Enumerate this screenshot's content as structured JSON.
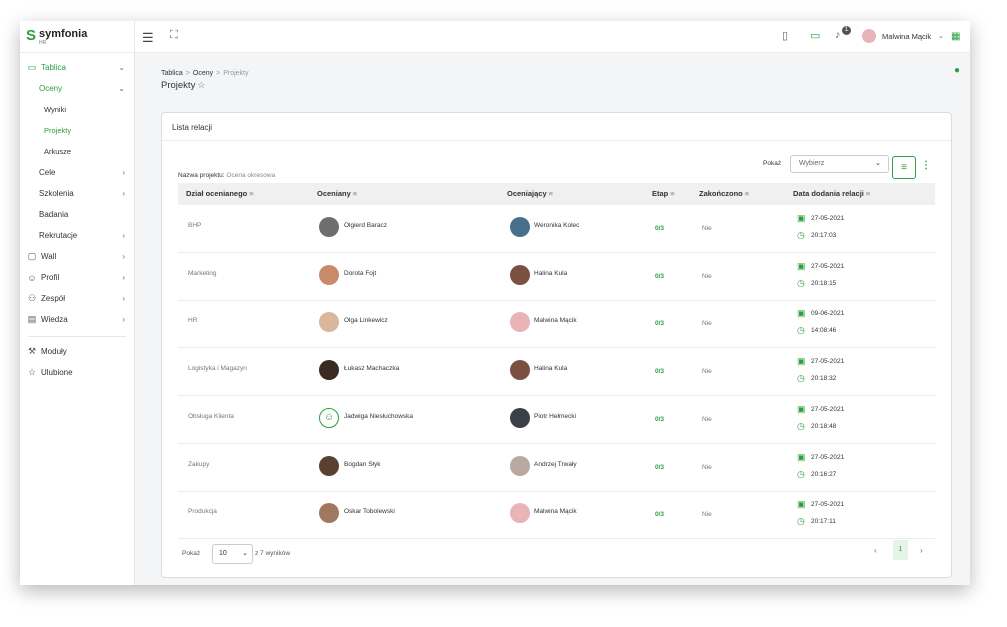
{
  "app": {
    "brand": "symfonia",
    "brand_sub": "HR"
  },
  "sidebar": {
    "items": [
      {
        "label": "Tablica",
        "icon": "monitor-icon",
        "chevron": "⌄",
        "state": "active"
      },
      {
        "label": "Oceny",
        "chevron": "⌄",
        "state": "active-sub"
      },
      {
        "label": "Wyniki",
        "state": "lvl3"
      },
      {
        "label": "Projekty",
        "state": "lvl3-active"
      },
      {
        "label": "Arkusze",
        "state": "lvl3"
      },
      {
        "label": "Cele",
        "chevron": "›",
        "state": "lvl2"
      },
      {
        "label": "Szkolenia",
        "chevron": "›",
        "state": "lvl2"
      },
      {
        "label": "Badania",
        "state": "lvl2"
      },
      {
        "label": "Rekrutacje",
        "chevron": "›",
        "state": "lvl2"
      },
      {
        "label": "Wall",
        "icon": "chat-icon",
        "chevron": "›",
        "state": "top"
      },
      {
        "label": "Profil",
        "icon": "user-icon",
        "chevron": "›",
        "state": "top"
      },
      {
        "label": "Zespół",
        "icon": "team-icon",
        "chevron": "›",
        "state": "top"
      },
      {
        "label": "Wiedza",
        "icon": "book-icon",
        "chevron": "›",
        "state": "top"
      },
      {
        "label": "Moduły",
        "icon": "wrench-icon",
        "state": "top"
      },
      {
        "label": "Ulubione",
        "icon": "star-icon",
        "state": "top"
      }
    ]
  },
  "topbar": {
    "notification_count": "1",
    "user_name": "Malwina Mącik"
  },
  "breadcrumb": {
    "items": [
      "Tablica",
      "Oceny",
      "Projekty"
    ]
  },
  "page_title": "Projekty",
  "card": {
    "title": "Lista relacji",
    "project_label": "Nazwa projektu:",
    "project_value": "Ocena okresowa",
    "show_label": "Pokaż",
    "select_placeholder": "Wybierz"
  },
  "table": {
    "columns": [
      "Dział ocenianego",
      "Oceniany",
      "Oceniający",
      "Etap",
      "Zakończono",
      "Data dodania relacji"
    ],
    "rows": [
      {
        "dept": "BHP",
        "evaluated": "Olgierd Baracz",
        "evaluator": "Weronika Kolec",
        "stage": "0/3",
        "finished": "Nie",
        "date": "27-05-2021",
        "time": "20:17:03",
        "av1": "#6e6e6e",
        "av2": "#4a6f8a"
      },
      {
        "dept": "Marketing",
        "evaluated": "Dorota Fojt",
        "evaluator": "Halina Kula",
        "stage": "0/3",
        "finished": "Nie",
        "date": "27-05-2021",
        "time": "20:18:15",
        "av1": "#c98a6a",
        "av2": "#7a5040"
      },
      {
        "dept": "HR",
        "evaluated": "Olga Linkewicz",
        "evaluator": "Malwina Mącik",
        "stage": "0/3",
        "finished": "Nie",
        "date": "09-06-2021",
        "time": "14:08:46",
        "av1": "#d9b79a",
        "av2": "#e8b4b8"
      },
      {
        "dept": "Logistyka i Magazyn",
        "evaluated": "Łukasz Machaczka",
        "evaluator": "Halina Kula",
        "stage": "0/3",
        "finished": "Nie",
        "date": "27-05-2021",
        "time": "20:18:32",
        "av1": "#3b2a22",
        "av2": "#7a5040"
      },
      {
        "dept": "Obsługa Klienta",
        "evaluated": "Jadwiga Niesłuchowska",
        "evaluator": "Piotr Hełmecki",
        "stage": "0/3",
        "finished": "Nie",
        "date": "27-05-2021",
        "time": "20:18:48",
        "av1": "outline",
        "av2": "#3a3f48"
      },
      {
        "dept": "Zakupy",
        "evaluated": "Bogdan Słyk",
        "evaluator": "Andrzej Trwały",
        "stage": "0/3",
        "finished": "Nie",
        "date": "27-05-2021",
        "time": "20:16:27",
        "av1": "#5a4030",
        "av2": "#b9a9a0"
      },
      {
        "dept": "Produkcja",
        "evaluated": "Oskar Tobolewski",
        "evaluator": "Malwina Mącik",
        "stage": "0/3",
        "finished": "Nie",
        "date": "27-05-2021",
        "time": "20:17:11",
        "av1": "#a07860",
        "av2": "#e8b4b8"
      }
    ]
  },
  "pagination": {
    "show_label": "Pokaż",
    "page_size": "10",
    "of_results": "z 7 wyników",
    "current_page": "1"
  },
  "colors": {
    "accent": "#2e9e3e",
    "header_bg": "#f0f0f0"
  }
}
